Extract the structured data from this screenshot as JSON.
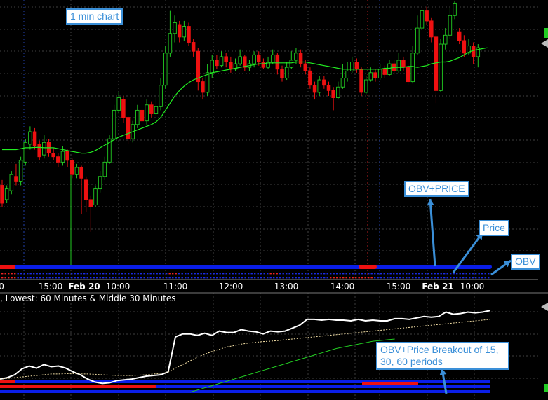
{
  "chart_data": [
    {
      "type": "candlestick",
      "title": "1 min chart",
      "x_tick_labels": [
        "0",
        "15:00",
        "Feb 20",
        "10:00",
        "11:00",
        "12:00",
        "13:00",
        "14:00",
        "15:00",
        "Feb 21",
        "10:00"
      ],
      "colors": {
        "up": "#22cc22",
        "down": "#ee1111",
        "moving_average": "#22ee22",
        "grid": "#555555",
        "session_divider": "#2b4fd8",
        "highlight_divider": "#cc2222"
      },
      "candles": [
        {
          "o": 8.0,
          "c": 7.0,
          "h": 8.3,
          "l": 6.8
        },
        {
          "o": 7.2,
          "c": 7.8,
          "h": 8.0,
          "l": 7.0
        },
        {
          "o": 7.7,
          "c": 8.6,
          "h": 8.8,
          "l": 7.5
        },
        {
          "o": 8.5,
          "c": 8.2,
          "h": 9.2,
          "l": 8.0
        },
        {
          "o": 8.2,
          "c": 9.4,
          "h": 9.6,
          "l": 8.0
        },
        {
          "o": 9.3,
          "c": 10.4,
          "h": 10.6,
          "l": 9.1
        },
        {
          "o": 10.3,
          "c": 11.0,
          "h": 11.3,
          "l": 10.0
        },
        {
          "o": 11.0,
          "c": 10.2,
          "h": 11.2,
          "l": 10.0
        },
        {
          "o": 10.3,
          "c": 9.6,
          "h": 10.5,
          "l": 9.4
        },
        {
          "o": 9.7,
          "c": 10.4,
          "h": 10.8,
          "l": 9.5
        },
        {
          "o": 10.4,
          "c": 9.8,
          "h": 10.6,
          "l": 9.6
        },
        {
          "o": 9.8,
          "c": 9.6,
          "h": 10.1,
          "l": 9.4
        },
        {
          "o": 9.6,
          "c": 9.3,
          "h": 9.8,
          "l": 9.0
        },
        {
          "o": 9.3,
          "c": 9.9,
          "h": 10.2,
          "l": 9.1
        },
        {
          "o": 9.9,
          "c": 9.4,
          "h": 10.0,
          "l": 9.0
        },
        {
          "o": 9.4,
          "c": 8.6,
          "h": 9.5,
          "l": 8.4
        },
        {
          "o": 8.6,
          "c": 9.0,
          "h": 9.2,
          "l": 8.4
        },
        {
          "o": 9.0,
          "c": 8.4,
          "h": 9.1,
          "l": 6.4
        },
        {
          "o": 8.3,
          "c": 7.2,
          "h": 8.5,
          "l": 6.5
        },
        {
          "o": 7.2,
          "c": 6.8,
          "h": 7.4,
          "l": 5.4
        },
        {
          "o": 6.9,
          "c": 7.8,
          "h": 8.0,
          "l": 6.8
        },
        {
          "o": 7.8,
          "c": 8.5,
          "h": 8.8,
          "l": 7.6
        },
        {
          "o": 8.5,
          "c": 9.3,
          "h": 9.6,
          "l": 8.3
        },
        {
          "o": 9.3,
          "c": 10.6,
          "h": 10.8,
          "l": 9.2
        },
        {
          "o": 10.6,
          "c": 12.2,
          "h": 12.5,
          "l": 10.5
        },
        {
          "o": 12.2,
          "c": 12.9,
          "h": 13.2,
          "l": 12.0
        },
        {
          "o": 12.8,
          "c": 11.8,
          "h": 13.0,
          "l": 11.5
        },
        {
          "o": 11.8,
          "c": 10.6,
          "h": 11.9,
          "l": 10.3
        },
        {
          "o": 10.6,
          "c": 11.4,
          "h": 11.6,
          "l": 10.4
        },
        {
          "o": 11.4,
          "c": 12.2,
          "h": 12.5,
          "l": 11.2
        },
        {
          "o": 12.2,
          "c": 11.6,
          "h": 12.4,
          "l": 11.4
        },
        {
          "o": 11.6,
          "c": 12.5,
          "h": 12.8,
          "l": 11.4
        },
        {
          "o": 12.5,
          "c": 12.0,
          "h": 12.7,
          "l": 11.8
        },
        {
          "o": 12.0,
          "c": 12.4,
          "h": 12.9,
          "l": 11.9
        },
        {
          "o": 12.4,
          "c": 13.6,
          "h": 14.0,
          "l": 12.2
        },
        {
          "o": 13.6,
          "c": 15.4,
          "h": 15.8,
          "l": 13.4
        },
        {
          "o": 15.4,
          "c": 16.5,
          "h": 17.8,
          "l": 15.2
        },
        {
          "o": 16.5,
          "c": 17.1,
          "h": 17.5,
          "l": 16.0
        },
        {
          "o": 17.0,
          "c": 16.3,
          "h": 17.2,
          "l": 16.0
        },
        {
          "o": 16.3,
          "c": 16.9,
          "h": 17.2,
          "l": 16.1
        },
        {
          "o": 16.9,
          "c": 16.0,
          "h": 17.1,
          "l": 15.8
        },
        {
          "o": 16.0,
          "c": 15.5,
          "h": 16.2,
          "l": 15.2
        },
        {
          "o": 15.5,
          "c": 13.8,
          "h": 15.7,
          "l": 13.3
        },
        {
          "o": 13.8,
          "c": 13.2,
          "h": 14.0,
          "l": 12.8
        },
        {
          "o": 13.2,
          "c": 14.3,
          "h": 14.8,
          "l": 13.0
        },
        {
          "o": 14.3,
          "c": 15.0,
          "h": 15.3,
          "l": 14.0
        },
        {
          "o": 15.0,
          "c": 14.7,
          "h": 15.3,
          "l": 14.5
        },
        {
          "o": 14.7,
          "c": 15.2,
          "h": 15.5,
          "l": 14.6
        },
        {
          "o": 15.2,
          "c": 14.9,
          "h": 15.4,
          "l": 14.6
        },
        {
          "o": 14.9,
          "c": 14.5,
          "h": 15.2,
          "l": 14.3
        },
        {
          "o": 14.5,
          "c": 14.8,
          "h": 15.1,
          "l": 14.4
        },
        {
          "o": 14.8,
          "c": 15.2,
          "h": 15.6,
          "l": 14.7
        },
        {
          "o": 15.2,
          "c": 14.6,
          "h": 15.3,
          "l": 14.4
        },
        {
          "o": 14.6,
          "c": 14.8,
          "h": 15.0,
          "l": 14.4
        },
        {
          "o": 14.8,
          "c": 15.3,
          "h": 15.5,
          "l": 14.6
        },
        {
          "o": 15.3,
          "c": 14.9,
          "h": 15.5,
          "l": 14.7
        },
        {
          "o": 14.9,
          "c": 14.6,
          "h": 15.1,
          "l": 14.5
        },
        {
          "o": 14.6,
          "c": 14.9,
          "h": 15.2,
          "l": 14.5
        },
        {
          "o": 14.9,
          "c": 15.3,
          "h": 15.6,
          "l": 14.8
        },
        {
          "o": 15.3,
          "c": 14.5,
          "h": 15.4,
          "l": 14.2
        },
        {
          "o": 14.5,
          "c": 14.0,
          "h": 14.7,
          "l": 13.8
        },
        {
          "o": 14.0,
          "c": 14.6,
          "h": 14.9,
          "l": 13.9
        },
        {
          "o": 14.6,
          "c": 15.0,
          "h": 15.5,
          "l": 14.5
        },
        {
          "o": 15.0,
          "c": 15.4,
          "h": 15.7,
          "l": 14.8
        },
        {
          "o": 15.4,
          "c": 14.8,
          "h": 15.6,
          "l": 14.6
        },
        {
          "o": 14.8,
          "c": 14.4,
          "h": 15.0,
          "l": 14.2
        },
        {
          "o": 14.4,
          "c": 13.6,
          "h": 14.6,
          "l": 13.4
        },
        {
          "o": 13.6,
          "c": 13.2,
          "h": 13.8,
          "l": 12.8
        },
        {
          "o": 13.2,
          "c": 13.9,
          "h": 14.1,
          "l": 13.0
        },
        {
          "o": 13.9,
          "c": 13.6,
          "h": 14.1,
          "l": 13.4
        },
        {
          "o": 13.6,
          "c": 13.3,
          "h": 13.8,
          "l": 13.0
        },
        {
          "o": 13.3,
          "c": 12.9,
          "h": 13.5,
          "l": 12.2
        },
        {
          "o": 12.9,
          "c": 13.5,
          "h": 13.8,
          "l": 12.8
        },
        {
          "o": 13.5,
          "c": 14.0,
          "h": 14.8,
          "l": 13.4
        },
        {
          "o": 14.0,
          "c": 14.4,
          "h": 14.9,
          "l": 13.8
        },
        {
          "o": 14.4,
          "c": 14.9,
          "h": 15.2,
          "l": 14.3
        },
        {
          "o": 14.9,
          "c": 14.5,
          "h": 15.1,
          "l": 14.3
        },
        {
          "o": 14.5,
          "c": 13.2,
          "h": 14.6,
          "l": 13.0
        },
        {
          "o": 13.2,
          "c": 13.9,
          "h": 14.1,
          "l": 13.1
        },
        {
          "o": 13.9,
          "c": 14.3,
          "h": 14.6,
          "l": 13.8
        },
        {
          "o": 14.3,
          "c": 14.0,
          "h": 14.5,
          "l": 13.8
        },
        {
          "o": 14.0,
          "c": 14.5,
          "h": 14.8,
          "l": 13.9
        },
        {
          "o": 14.5,
          "c": 14.2,
          "h": 14.7,
          "l": 14.0
        },
        {
          "o": 14.2,
          "c": 14.8,
          "h": 15.0,
          "l": 14.1
        },
        {
          "o": 14.8,
          "c": 14.4,
          "h": 15.0,
          "l": 14.2
        },
        {
          "o": 14.4,
          "c": 15.0,
          "h": 15.4,
          "l": 14.3
        },
        {
          "o": 15.0,
          "c": 14.6,
          "h": 15.2,
          "l": 14.4
        },
        {
          "o": 14.6,
          "c": 13.8,
          "h": 14.8,
          "l": 13.6
        },
        {
          "o": 13.8,
          "c": 15.4,
          "h": 15.8,
          "l": 13.7
        },
        {
          "o": 15.4,
          "c": 16.8,
          "h": 17.5,
          "l": 15.3
        },
        {
          "o": 16.8,
          "c": 17.8,
          "h": 18.2,
          "l": 16.6
        },
        {
          "o": 17.8,
          "c": 17.2,
          "h": 18.0,
          "l": 17.0
        },
        {
          "o": 17.2,
          "c": 16.3,
          "h": 17.4,
          "l": 16.0
        },
        {
          "o": 16.3,
          "c": 13.3,
          "h": 16.4,
          "l": 12.6
        },
        {
          "o": 13.3,
          "c": 15.9,
          "h": 16.2,
          "l": 13.2
        },
        {
          "o": 15.9,
          "c": 16.4,
          "h": 16.8,
          "l": 15.6
        },
        {
          "o": 16.4,
          "c": 17.5,
          "h": 17.9,
          "l": 16.2
        },
        {
          "o": 17.5,
          "c": 18.2,
          "h": 18.3,
          "l": 17.3
        },
        {
          "o": 16.6,
          "c": 16.1,
          "h": 16.8,
          "l": 15.9
        },
        {
          "o": 16.1,
          "c": 15.4,
          "h": 16.4,
          "l": 15.2
        },
        {
          "o": 15.4,
          "c": 15.8,
          "h": 16.2,
          "l": 15.3
        },
        {
          "o": 15.8,
          "c": 15.2,
          "h": 16.0,
          "l": 14.8
        },
        {
          "o": 15.2,
          "c": 15.7,
          "h": 15.9,
          "l": 14.6
        }
      ],
      "moving_average": [
        10.0,
        10.0,
        10.0,
        10.0,
        10.05,
        10.1,
        10.1,
        10.12,
        10.12,
        10.1,
        10.1,
        10.1,
        10.05,
        10.0,
        9.95,
        9.9,
        9.85,
        9.8,
        9.8,
        9.85,
        9.95,
        10.1,
        10.25,
        10.4,
        10.55,
        10.7,
        10.8,
        10.9,
        11.0,
        11.1,
        11.2,
        11.3,
        11.4,
        11.55,
        11.8,
        12.2,
        12.6,
        13.0,
        13.3,
        13.55,
        13.75,
        13.9,
        14.0,
        14.1,
        14.2,
        14.3,
        14.35,
        14.4,
        14.45,
        14.5,
        14.55,
        14.6,
        14.65,
        14.7,
        14.75,
        14.8,
        14.8,
        14.85,
        14.85,
        14.85,
        14.85,
        14.85,
        14.85,
        14.9,
        14.9,
        14.9,
        14.85,
        14.8,
        14.75,
        14.7,
        14.65,
        14.6,
        14.55,
        14.5,
        14.5,
        14.5,
        14.5,
        14.5,
        14.5,
        14.5,
        14.5,
        14.5,
        14.55,
        14.55,
        14.6,
        14.6,
        14.6,
        14.65,
        14.65,
        14.6,
        14.65,
        14.7,
        14.8,
        14.85,
        14.9,
        14.9,
        14.95,
        15.05,
        15.15,
        15.3,
        15.45,
        15.55,
        15.6,
        15.65,
        15.7
      ]
    },
    {
      "type": "line",
      "title": ", Lowest: 60 Minutes & Middle 30 Minutes",
      "series": [
        {
          "color": "#ffffff",
          "style": "solid",
          "values": [
            1.0,
            1.2,
            1.6,
            2.4,
            2.8,
            2.5,
            3.0,
            2.7,
            2.8,
            2.5,
            2.0,
            1.6,
            1.0,
            0.6,
            0.4,
            0.5,
            0.8,
            0.9,
            1.0,
            1.2,
            1.4,
            1.5,
            1.6,
            2.0,
            6.8,
            7.2,
            7.2,
            7.0,
            7.3,
            7.0,
            7.6,
            7.4,
            7.4,
            7.8,
            7.6,
            7.5,
            7.2,
            7.6,
            7.5,
            7.6,
            8.0,
            8.4,
            9.2,
            9.2,
            9.1,
            9.2,
            9.1,
            9.1,
            9.0,
            9.2,
            9.0,
            9.1,
            9.0,
            9.0,
            9.3,
            9.3,
            9.2,
            9.4,
            9.6,
            9.5,
            9.6,
            10.2,
            9.9,
            10.0,
            10.2,
            10.1,
            10.2,
            10.4
          ]
        },
        {
          "color": "#f3dfa6",
          "style": "dotted",
          "values": [
            1.0,
            1.1,
            1.2,
            1.3,
            1.4,
            1.5,
            1.6,
            1.7,
            1.7,
            1.75,
            1.75,
            1.7,
            1.7,
            1.65,
            1.6,
            1.55,
            1.5,
            1.5,
            1.5,
            1.55,
            1.6,
            1.7,
            1.8,
            1.95,
            2.5,
            3.0,
            3.5,
            4.0,
            4.4,
            4.8,
            5.1,
            5.4,
            5.6,
            5.8,
            5.95,
            6.05,
            6.15,
            6.2,
            6.3,
            6.4,
            6.5,
            6.6,
            6.7,
            6.8,
            6.9,
            7.0,
            7.1,
            7.2,
            7.3,
            7.4,
            7.5,
            7.6,
            7.7,
            7.8,
            7.9,
            8.0,
            8.1,
            8.2,
            8.3,
            8.4,
            8.5,
            8.6,
            8.7,
            8.8,
            8.9,
            9.0,
            9.1,
            9.2
          ]
        },
        {
          "color": "#22cc22",
          "style": "solid",
          "values": [
            null,
            null,
            null,
            null,
            null,
            null,
            null,
            null,
            null,
            null,
            null,
            null,
            null,
            null,
            null,
            null,
            null,
            null,
            null,
            null,
            null,
            null,
            null,
            null,
            null,
            null,
            -0.8,
            -0.5,
            -0.2,
            0.1,
            0.4,
            0.7,
            1.0,
            1.3,
            1.6,
            1.9,
            2.2,
            2.5,
            2.8,
            3.1,
            3.4,
            3.7,
            4.0,
            4.3,
            4.6,
            4.9,
            5.2,
            5.4,
            5.6,
            5.8,
            6.0,
            6.2,
            6.3,
            6.4,
            6.5,
            null,
            null,
            null,
            null,
            null,
            null,
            null,
            null,
            null,
            null,
            null,
            null,
            null
          ]
        }
      ],
      "ylim": [
        -1,
        11.5
      ]
    }
  ],
  "labels": {
    "chart_title": "1 min chart",
    "obv_price": "OBV+PRICE",
    "price": "Price",
    "obv": "OBV",
    "breakout": "OBV+Price Breakout of 15, 30, 60 periods"
  }
}
